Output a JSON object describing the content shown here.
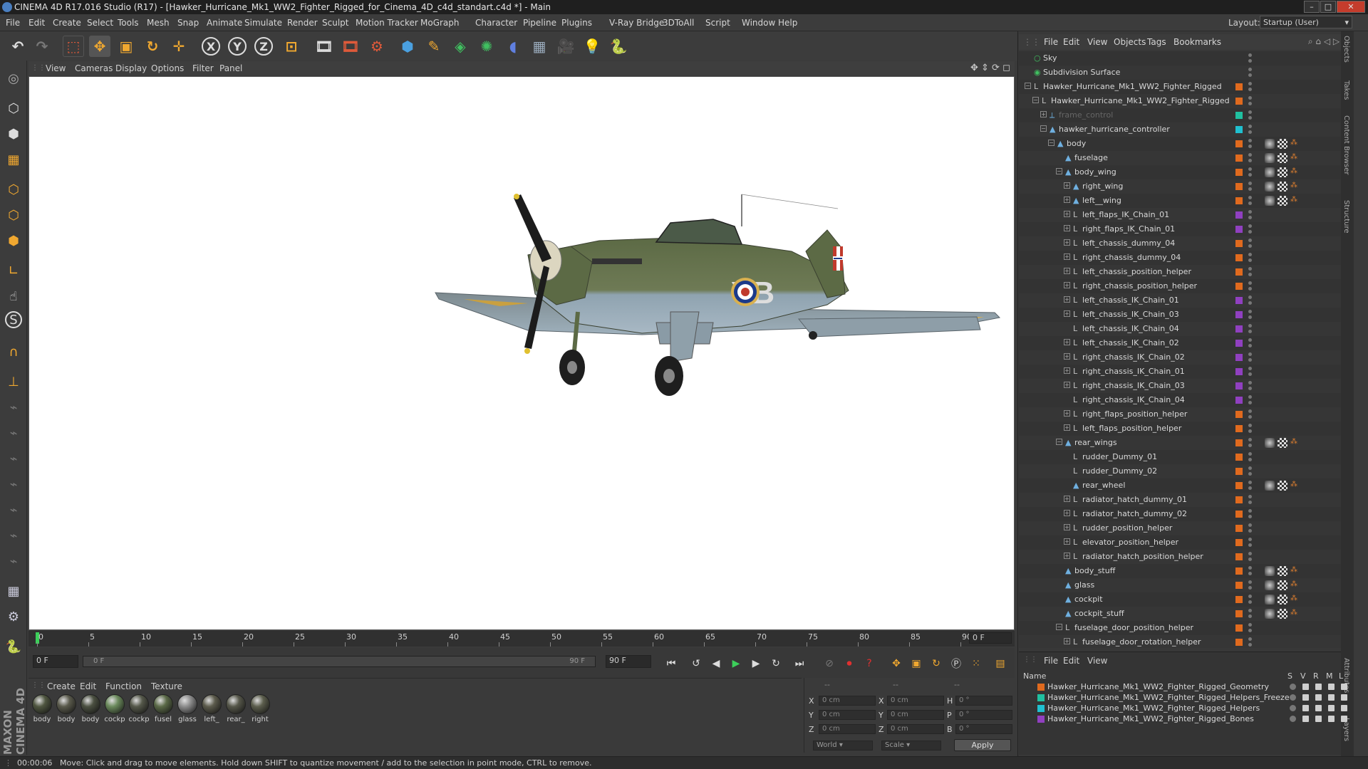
{
  "window": {
    "title": "CINEMA 4D R17.016 Studio (R17) - [Hawker_Hurricane_Mk1_WW2_Fighter_Rigged_for_Cinema_4D_c4d_standart.c4d *] - Main",
    "min": "–",
    "max": "□",
    "close": "✕"
  },
  "menubar": [
    "File",
    "Edit",
    "Create",
    "Select",
    "Tools",
    "Mesh",
    "Snap",
    "Animate",
    "Simulate",
    "Render",
    "Sculpt",
    "Motion Tracker",
    "MoGraph",
    "Character",
    "Pipeline",
    "Plugins",
    "V-Ray Bridge",
    "3DToAll",
    "Script",
    "Window",
    "Help"
  ],
  "layout": {
    "label": "Layout:",
    "value": "Startup (User)"
  },
  "viewport_menu": [
    "View",
    "Cameras",
    "Display",
    "Options",
    "Filter",
    "Panel"
  ],
  "timeline": {
    "ticks": [
      "0",
      "5",
      "10",
      "15",
      "20",
      "25",
      "30",
      "35",
      "40",
      "45",
      "50",
      "55",
      "60",
      "65",
      "70",
      "75",
      "80",
      "85",
      "90"
    ],
    "frame_field": "0 F"
  },
  "transport": {
    "start": "0 F",
    "range_start": "0 F",
    "range_end": "90 F",
    "end": "90 F"
  },
  "material_menu": [
    "Create",
    "Edit",
    "Function",
    "Texture"
  ],
  "materials": [
    {
      "label": "body",
      "color": "#4f5640"
    },
    {
      "label": "body",
      "color": "#5a5a4c"
    },
    {
      "label": "body",
      "color": "#4b5041"
    },
    {
      "label": "cockp",
      "color": "#6b8a5c"
    },
    {
      "label": "cockp",
      "color": "#55584a"
    },
    {
      "label": "fusel",
      "color": "#5b6a48"
    },
    {
      "label": "glass",
      "color": "#8d8d8d"
    },
    {
      "label": "left_",
      "color": "#5c5b4c"
    },
    {
      "label": "rear_",
      "color": "#56574a"
    },
    {
      "label": "right",
      "color": "#5c5e4d"
    }
  ],
  "coords": {
    "headers": [
      "--",
      "--",
      "--"
    ],
    "X": {
      "pos": "0 cm",
      "size": "0 cm",
      "rot_label": "H",
      "rot": "0 °"
    },
    "Y": {
      "pos": "0 cm",
      "size": "0 cm",
      "rot_label": "P",
      "rot": "0 °"
    },
    "Z": {
      "pos": "0 cm",
      "size": "0 cm",
      "rot_label": "B",
      "rot": "0 °"
    },
    "world": "World",
    "scale": "Scale",
    "apply": "Apply"
  },
  "status": {
    "time": "00:00:06",
    "text": "Move: Click and drag to move elements. Hold down SHIFT to quantize movement / add to the selection in point mode, CTRL to remove."
  },
  "maxon": "MAXON CINEMA 4D",
  "object_menu": [
    "File",
    "Edit",
    "View",
    "Objects",
    "Tags",
    "Bookmarks"
  ],
  "objects": [
    {
      "name": "Sky",
      "depth": 0,
      "exp": "",
      "icon": "○",
      "color": ""
    },
    {
      "name": "Subdivision Surface",
      "depth": 0,
      "exp": "",
      "icon": "◉",
      "color": ""
    },
    {
      "name": "Hawker_Hurricane_Mk1_WW2_Fighter_Rigged",
      "depth": 0,
      "exp": "−",
      "icon": "L",
      "color": "#e06a1e"
    },
    {
      "name": "Hawker_Hurricane_Mk1_WW2_Fighter_Rigged",
      "depth": 1,
      "exp": "−",
      "icon": "L",
      "color": "#e06a1e"
    },
    {
      "name": "frame_control",
      "depth": 2,
      "exp": "+",
      "icon": "⟂",
      "color": "#20c0a0",
      "dim": true
    },
    {
      "name": "hawker_hurricane_controller",
      "depth": 2,
      "exp": "−",
      "icon": "▲",
      "color": "#20c0d0"
    },
    {
      "name": "body",
      "depth": 3,
      "exp": "−",
      "icon": "▲",
      "color": "#e06a1e"
    },
    {
      "name": "fuselage",
      "depth": 4,
      "exp": "",
      "icon": "▲",
      "color": "#e06a1e"
    },
    {
      "name": "body_wing",
      "depth": 4,
      "exp": "−",
      "icon": "▲",
      "color": "#e06a1e"
    },
    {
      "name": "right_wing",
      "depth": 5,
      "exp": "+",
      "icon": "▲",
      "color": "#e06a1e"
    },
    {
      "name": "left__wing",
      "depth": 5,
      "exp": "+",
      "icon": "▲",
      "color": "#e06a1e"
    },
    {
      "name": "left_flaps_IK_Chain_01",
      "depth": 5,
      "exp": "+",
      "icon": "L",
      "color": "#9040c0"
    },
    {
      "name": "right_flaps_IK_Chain_01",
      "depth": 5,
      "exp": "+",
      "icon": "L",
      "color": "#9040c0"
    },
    {
      "name": "left_chassis_dummy_04",
      "depth": 5,
      "exp": "+",
      "icon": "L",
      "color": "#e06a1e"
    },
    {
      "name": "right_chassis_dummy_04",
      "depth": 5,
      "exp": "+",
      "icon": "L",
      "color": "#e06a1e"
    },
    {
      "name": "left_chassis_position_helper",
      "depth": 5,
      "exp": "+",
      "icon": "L",
      "color": "#e06a1e"
    },
    {
      "name": "right_chassis_position_helper",
      "depth": 5,
      "exp": "+",
      "icon": "L",
      "color": "#e06a1e"
    },
    {
      "name": "left_chassis_IK_Chain_01",
      "depth": 5,
      "exp": "+",
      "icon": "L",
      "color": "#9040c0"
    },
    {
      "name": "left_chassis_IK_Chain_03",
      "depth": 5,
      "exp": "+",
      "icon": "L",
      "color": "#9040c0"
    },
    {
      "name": "left_chassis_IK_Chain_04",
      "depth": 5,
      "exp": "",
      "icon": "L",
      "color": "#9040c0"
    },
    {
      "name": "left_chassis_IK_Chain_02",
      "depth": 5,
      "exp": "+",
      "icon": "L",
      "color": "#9040c0"
    },
    {
      "name": "right_chassis_IK_Chain_02",
      "depth": 5,
      "exp": "+",
      "icon": "L",
      "color": "#9040c0"
    },
    {
      "name": "right_chassis_IK_Chain_01",
      "depth": 5,
      "exp": "+",
      "icon": "L",
      "color": "#9040c0"
    },
    {
      "name": "right_chassis_IK_Chain_03",
      "depth": 5,
      "exp": "+",
      "icon": "L",
      "color": "#9040c0"
    },
    {
      "name": "right_chassis_IK_Chain_04",
      "depth": 5,
      "exp": "",
      "icon": "L",
      "color": "#9040c0"
    },
    {
      "name": "right_flaps_position_helper",
      "depth": 5,
      "exp": "+",
      "icon": "L",
      "color": "#e06a1e"
    },
    {
      "name": "left_flaps_position_helper",
      "depth": 5,
      "exp": "+",
      "icon": "L",
      "color": "#e06a1e"
    },
    {
      "name": "rear_wings",
      "depth": 4,
      "exp": "−",
      "icon": "▲",
      "color": "#e06a1e"
    },
    {
      "name": "rudder_Dummy_01",
      "depth": 5,
      "exp": "",
      "icon": "L",
      "color": "#e06a1e"
    },
    {
      "name": "rudder_Dummy_02",
      "depth": 5,
      "exp": "",
      "icon": "L",
      "color": "#e06a1e"
    },
    {
      "name": "rear_wheel",
      "depth": 5,
      "exp": "",
      "icon": "▲",
      "color": "#e06a1e"
    },
    {
      "name": "radiator_hatch_dummy_01",
      "depth": 5,
      "exp": "+",
      "icon": "L",
      "color": "#e06a1e"
    },
    {
      "name": "radiator_hatch_dummy_02",
      "depth": 5,
      "exp": "+",
      "icon": "L",
      "color": "#e06a1e"
    },
    {
      "name": "rudder_position_helper",
      "depth": 5,
      "exp": "+",
      "icon": "L",
      "color": "#e06a1e"
    },
    {
      "name": "elevator_position_helper",
      "depth": 5,
      "exp": "+",
      "icon": "L",
      "color": "#e06a1e"
    },
    {
      "name": "radiator_hatch_position_helper",
      "depth": 5,
      "exp": "+",
      "icon": "L",
      "color": "#e06a1e"
    },
    {
      "name": "body_stuff",
      "depth": 4,
      "exp": "",
      "icon": "▲",
      "color": "#e06a1e"
    },
    {
      "name": "glass",
      "depth": 4,
      "exp": "",
      "icon": "▲",
      "color": "#e06a1e"
    },
    {
      "name": "cockpit",
      "depth": 4,
      "exp": "",
      "icon": "▲",
      "color": "#e06a1e"
    },
    {
      "name": "cockpit_stuff",
      "depth": 4,
      "exp": "",
      "icon": "▲",
      "color": "#e06a1e"
    },
    {
      "name": "fuselage_door_position_helper",
      "depth": 4,
      "exp": "−",
      "icon": "L",
      "color": "#e06a1e"
    },
    {
      "name": "fuselage_door_rotation_helper",
      "depth": 5,
      "exp": "+",
      "icon": "L",
      "color": "#e06a1e"
    }
  ],
  "layer_menu": [
    "File",
    "Edit",
    "View"
  ],
  "layer_header": {
    "name": "Name",
    "cols": [
      "S",
      "V",
      "R",
      "M",
      "L"
    ]
  },
  "layers": [
    {
      "name": "Hawker_Hurricane_Mk1_WW2_Fighter_Rigged_Geometry",
      "color": "#e06a1e"
    },
    {
      "name": "Hawker_Hurricane_Mk1_WW2_Fighter_Rigged_Helpers_Freeze",
      "color": "#20c0a0"
    },
    {
      "name": "Hawker_Hurricane_Mk1_WW2_Fighter_Rigged_Helpers",
      "color": "#20c0d0"
    },
    {
      "name": "Hawker_Hurricane_Mk1_WW2_Fighter_Rigged_Bones",
      "color": "#9040c0"
    }
  ],
  "side_tabs": [
    "Objects",
    "Takes",
    "Content Browser",
    "Structure"
  ],
  "side_tabs_bottom": [
    "Attributes",
    "Layers"
  ],
  "aircraft": {
    "code_letters": "YB"
  }
}
